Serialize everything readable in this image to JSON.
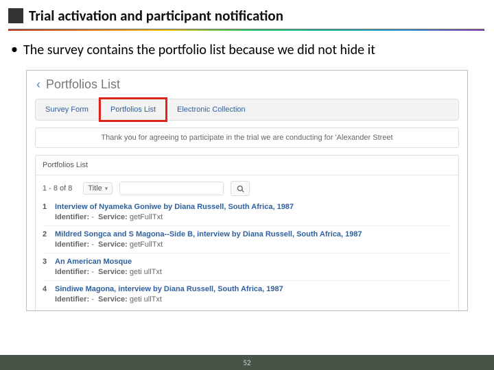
{
  "title": "Trial activation and participant notification",
  "bullet": "The survey contains the portfolio list because we did not hide it",
  "screenshot": {
    "breadcrumb": "Portfolios List",
    "tabs": {
      "survey": "Survey Form",
      "portfolios": "Portfolios List",
      "ecoll": "Electronic Collection"
    },
    "thanks": "Thank you for agreeing to participate in the trial we are conducting for 'Alexander Street",
    "panel_title": "Portfolios List",
    "count": "1 - 8 of 8",
    "sort_field": "Title",
    "rows": [
      {
        "n": "1",
        "title": "Interview of Nyameka Goniwe by Diana Russell, South Africa, 1987",
        "identifier": "-",
        "service": "getFullTxt"
      },
      {
        "n": "2",
        "title": "Mildred Songca and S Magona--Side B, interview by Diana Russell, South Africa, 1987",
        "identifier": "-",
        "service": "getFullTxt"
      },
      {
        "n": "3",
        "title": "An American Mosque",
        "identifier": "-",
        "service": "geti ullTxt"
      },
      {
        "n": "4",
        "title": "Sindiwe Magona, interview by Diana Russell, South Africa, 1987",
        "identifier": "-",
        "service": "geti ullTxt"
      }
    ],
    "meta_labels": {
      "identifier": "Identifier:",
      "service": "Service:"
    }
  },
  "page_number": "52"
}
